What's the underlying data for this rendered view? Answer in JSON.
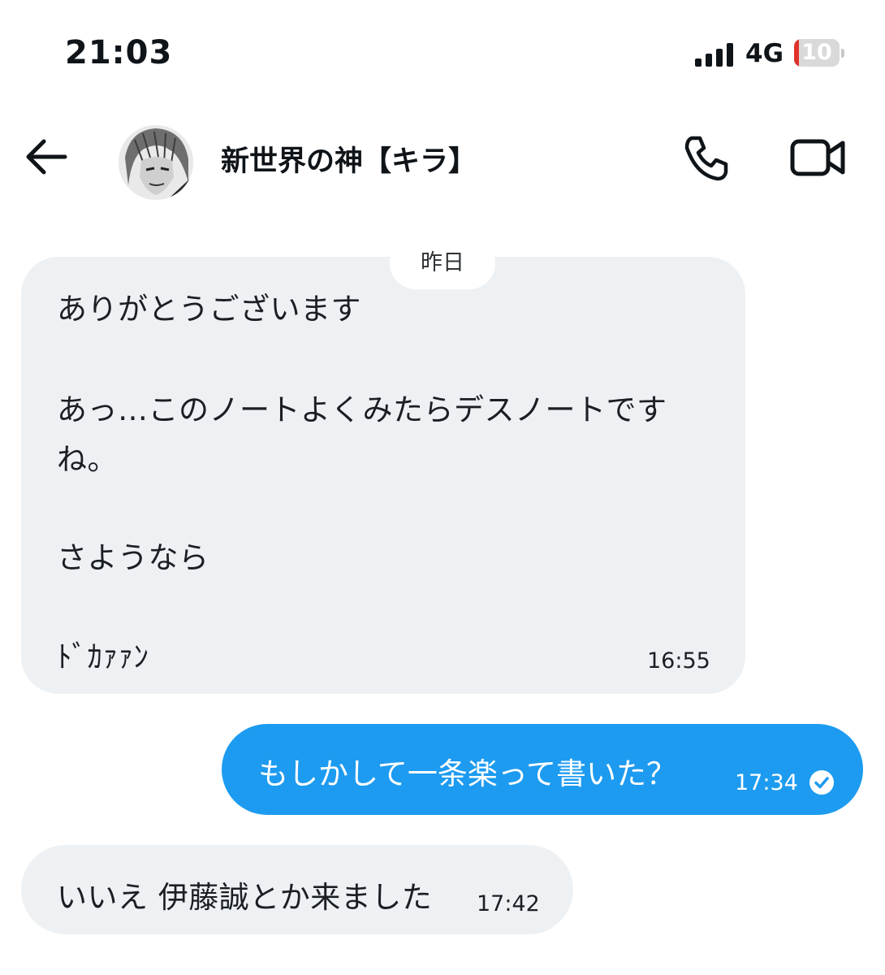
{
  "status_bar": {
    "time": "21:03",
    "network": "4G",
    "battery_level": "10",
    "signal_icon": "signal-bars-icon",
    "battery_color": "#e0322b"
  },
  "header": {
    "contact_name": "新世界の神【キラ】",
    "icons": [
      "back-arrow-icon",
      "phone-icon",
      "video-camera-icon"
    ]
  },
  "conversation": {
    "date_separator": "昨日",
    "messages": [
      {
        "direction": "incoming",
        "lines": [
          "ありがとうございます",
          "あっ…このノートよくみたらデスノートです",
          "ね。",
          "さようなら",
          "ﾄﾞｶｧｧﾝ"
        ],
        "time": "16:55"
      },
      {
        "direction": "outgoing",
        "text": "もしかして一条楽って書いた？",
        "time": "17:34",
        "status_icon": "read-check-icon"
      },
      {
        "direction": "incoming",
        "text": "いいえ 伊藤誠とか来ました",
        "time": "17:42"
      }
    ]
  },
  "colors": {
    "outgoing_bubble": "#1d9bf0",
    "incoming_bubble": "#eef1f3"
  }
}
